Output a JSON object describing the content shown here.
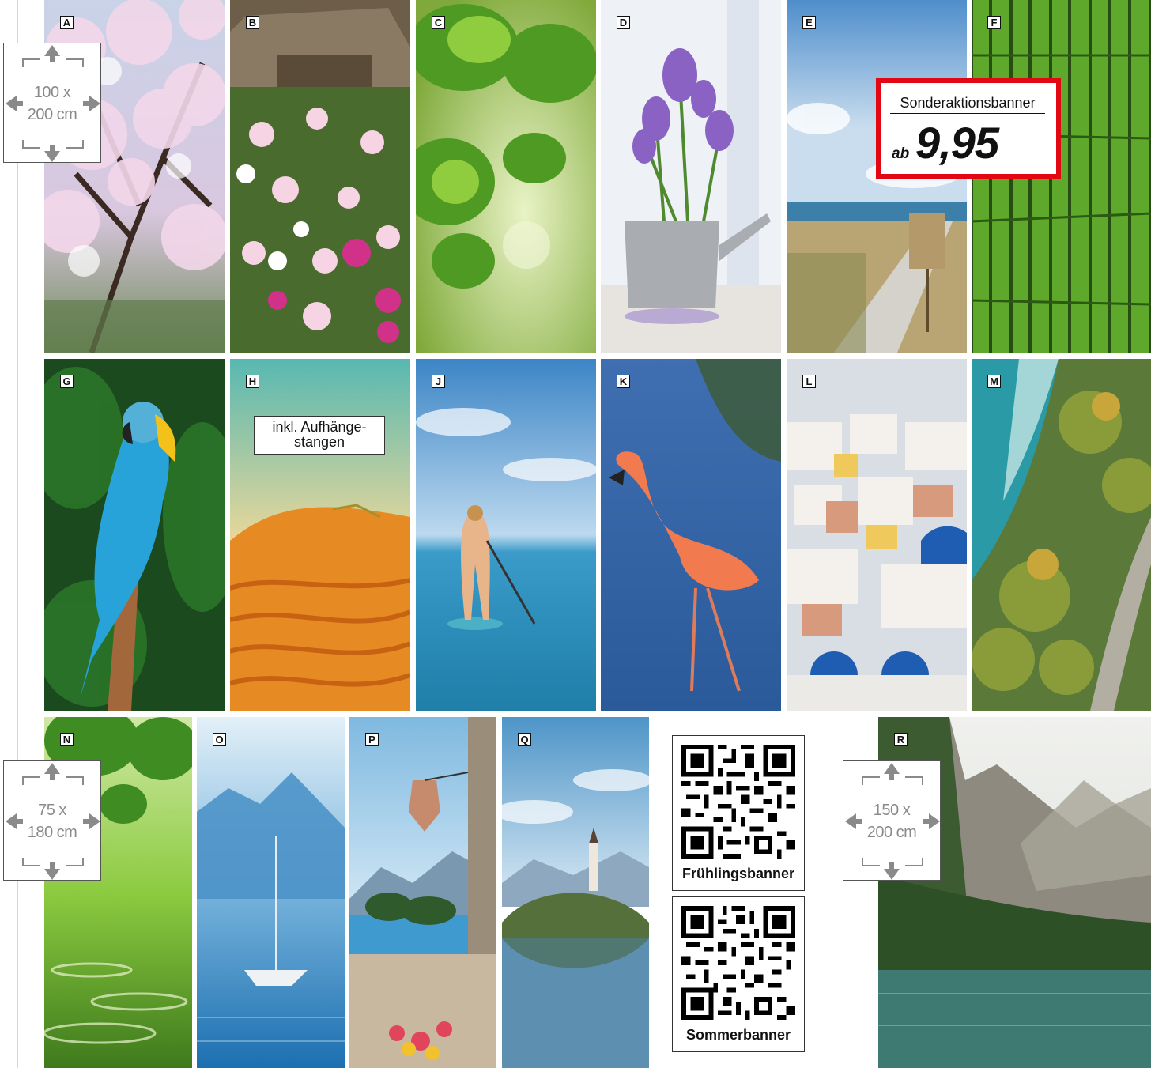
{
  "panels": [
    {
      "letter": "A"
    },
    {
      "letter": "B"
    },
    {
      "letter": "C"
    },
    {
      "letter": "D"
    },
    {
      "letter": "E"
    },
    {
      "letter": "F"
    },
    {
      "letter": "G"
    },
    {
      "letter": "H"
    },
    {
      "letter": "J"
    },
    {
      "letter": "K"
    },
    {
      "letter": "L"
    },
    {
      "letter": "M"
    },
    {
      "letter": "N"
    },
    {
      "letter": "O"
    },
    {
      "letter": "P"
    },
    {
      "letter": "Q"
    },
    {
      "letter": "R"
    }
  ],
  "sizes": {
    "large": {
      "line1": "100 x",
      "line2": "200 cm"
    },
    "small": {
      "line1": "75 x",
      "line2": "180 cm"
    },
    "wide": {
      "line1": "150 x",
      "line2": "200 cm"
    }
  },
  "promo": {
    "title": "Sonderaktionsbanner",
    "prefix": "ab",
    "price": "9,95",
    "border_color": "#e30613"
  },
  "note": {
    "line1": "inkl. Aufhänge-",
    "line2": "stangen"
  },
  "qr": {
    "spring_label": "Frühlingsbanner",
    "summer_label": "Sommerbanner"
  }
}
